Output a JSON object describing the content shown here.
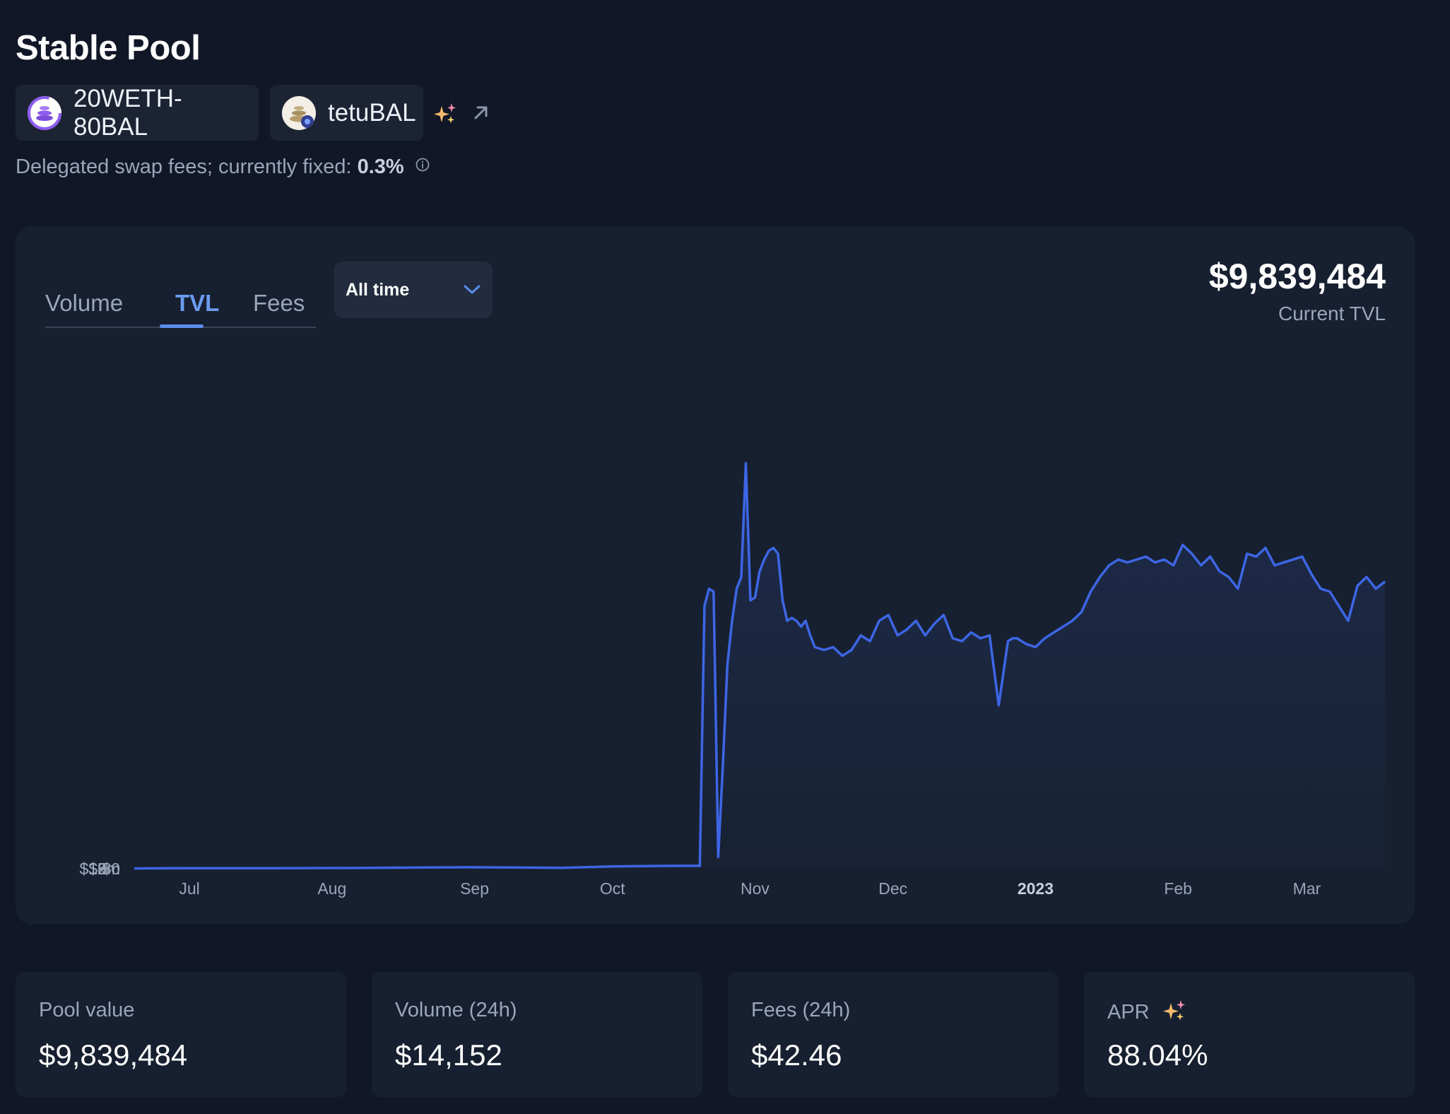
{
  "header": {
    "title": "Stable Pool",
    "tokens": [
      {
        "label": "20WETH-80BAL",
        "icon": "balancer-pool-token-icon"
      },
      {
        "label": "tetuBAL",
        "icon": "tetu-token-icon"
      }
    ],
    "fee_text": "Delegated swap fees; currently fixed: ",
    "fee_value": "0.3%"
  },
  "chart_panel": {
    "tabs": [
      {
        "label": "Volume"
      },
      {
        "label": "TVL"
      },
      {
        "label": "Fees"
      }
    ],
    "active_tab": "TVL",
    "period": "All time",
    "headline_value": "$9,839,484",
    "headline_caption": "Current TVL"
  },
  "chart_data": {
    "type": "area",
    "x_tick_labels": [
      "Jul",
      "Aug",
      "Sep",
      "Oct",
      "Nov",
      "Dec",
      "2023",
      "Feb",
      "Mar"
    ],
    "y_tick_labels": [
      "$0",
      "$3m",
      "$6m",
      "$9m",
      "$12m",
      "$15m"
    ],
    "ylim": [
      0,
      15000000
    ],
    "grid": false,
    "x_start": "2022-06-19",
    "series": [
      {
        "color": "#3d66e5",
        "x": [
          "2022-06-19",
          "2022-07-01",
          "2022-07-20",
          "2022-08-10",
          "2022-08-30",
          "2022-09-10",
          "2022-09-20",
          "2022-10-01",
          "2022-10-15",
          "2022-10-20",
          "2022-10-21",
          "2022-10-22",
          "2022-10-23",
          "2022-10-24",
          "2022-10-25",
          "2022-10-26",
          "2022-10-27",
          "2022-10-28",
          "2022-10-29",
          "2022-10-30",
          "2022-10-31",
          "2022-11-01",
          "2022-11-02",
          "2022-11-03",
          "2022-11-04",
          "2022-11-05",
          "2022-11-06",
          "2022-11-07",
          "2022-11-08",
          "2022-11-09",
          "2022-11-10",
          "2022-11-11",
          "2022-11-12",
          "2022-11-13",
          "2022-11-14",
          "2022-11-16",
          "2022-11-18",
          "2022-11-20",
          "2022-11-22",
          "2022-11-24",
          "2022-11-26",
          "2022-11-28",
          "2022-11-30",
          "2022-12-02",
          "2022-12-04",
          "2022-12-06",
          "2022-12-08",
          "2022-12-10",
          "2022-12-12",
          "2022-12-14",
          "2022-12-16",
          "2022-12-18",
          "2022-12-20",
          "2022-12-22",
          "2022-12-24",
          "2022-12-26",
          "2022-12-27",
          "2022-12-28",
          "2022-12-30",
          "2023-01-01",
          "2023-01-03",
          "2023-01-05",
          "2023-01-07",
          "2023-01-09",
          "2023-01-11",
          "2023-01-13",
          "2023-01-15",
          "2023-01-17",
          "2023-01-19",
          "2023-01-21",
          "2023-01-23",
          "2023-01-25",
          "2023-01-27",
          "2023-01-29",
          "2023-01-31",
          "2023-02-02",
          "2023-02-04",
          "2023-02-06",
          "2023-02-08",
          "2023-02-10",
          "2023-02-12",
          "2023-02-14",
          "2023-02-16",
          "2023-02-18",
          "2023-02-20",
          "2023-02-22",
          "2023-02-24",
          "2023-02-26",
          "2023-02-28",
          "2023-03-02",
          "2023-03-04",
          "2023-03-06",
          "2023-03-08",
          "2023-03-10",
          "2023-03-12",
          "2023-03-14",
          "2023-03-16",
          "2023-03-18"
        ],
        "values": [
          0.01,
          0.02,
          0.02,
          0.03,
          0.05,
          0.04,
          0.03,
          0.08,
          0.1,
          0.1,
          9.0,
          9.6,
          9.5,
          0.4,
          3.5,
          7.0,
          8.5,
          9.6,
          10.0,
          13.9,
          9.2,
          9.3,
          10.2,
          10.6,
          10.9,
          11.0,
          10.8,
          9.2,
          8.5,
          8.6,
          8.5,
          8.3,
          8.5,
          8.0,
          7.6,
          7.5,
          7.6,
          7.3,
          7.5,
          8.0,
          7.8,
          8.5,
          8.7,
          8.0,
          8.2,
          8.5,
          8.0,
          8.4,
          8.7,
          7.9,
          7.8,
          8.1,
          7.9,
          8.0,
          5.6,
          7.8,
          7.9,
          7.9,
          7.7,
          7.6,
          7.9,
          8.1,
          8.3,
          8.5,
          8.8,
          9.5,
          10.0,
          10.4,
          10.6,
          10.5,
          10.6,
          10.7,
          10.5,
          10.6,
          10.4,
          11.1,
          10.8,
          10.4,
          10.7,
          10.2,
          10.0,
          9.6,
          10.8,
          10.7,
          11.0,
          10.4,
          10.5,
          10.6,
          10.7,
          10.1,
          9.6,
          9.5,
          9.0,
          8.5,
          9.7,
          10.0,
          9.6,
          9.84
        ]
      }
    ]
  },
  "stats": [
    {
      "label": "Pool value",
      "value": "$9,839,484"
    },
    {
      "label": "Volume (24h)",
      "value": "$14,152"
    },
    {
      "label": "Fees (24h)",
      "value": "$42.46"
    },
    {
      "label": "APR",
      "value": "88.04%"
    }
  ]
}
